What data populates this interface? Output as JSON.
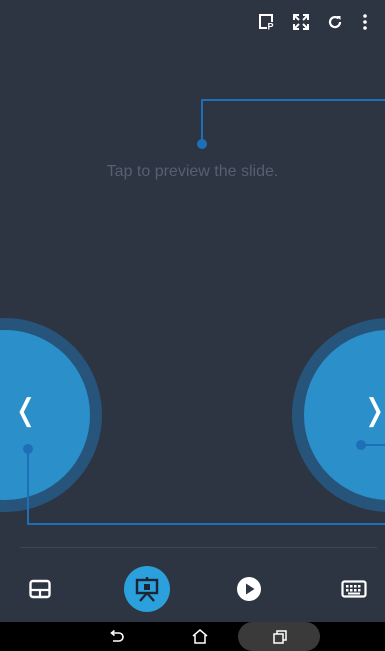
{
  "app": {
    "hint": "Tap to preview the slide."
  },
  "toolbar": {
    "icons": [
      "presenter-notes-icon",
      "fullscreen-icon",
      "refresh-icon",
      "more-vert-icon"
    ]
  },
  "navigation": {
    "previous_glyph": "❬",
    "next_glyph": "❭"
  },
  "bottom_bar": {
    "items": [
      {
        "name": "touchpad-mode",
        "icon": "touchpad-icon",
        "active": false
      },
      {
        "name": "presentation-mode",
        "icon": "presentation-icon",
        "active": true
      },
      {
        "name": "play-mode",
        "icon": "play-icon",
        "active": false
      },
      {
        "name": "keyboard-mode",
        "icon": "keyboard-icon",
        "active": false
      }
    ]
  },
  "system_nav": {
    "icons": [
      "back-icon",
      "home-icon",
      "recent-apps-icon"
    ]
  },
  "colors": {
    "background": "#2d3442",
    "accent": "#2b8fc9",
    "accent_active": "#2ba0dc",
    "connector": "#1f6fb8",
    "hint_text": "#556071"
  }
}
